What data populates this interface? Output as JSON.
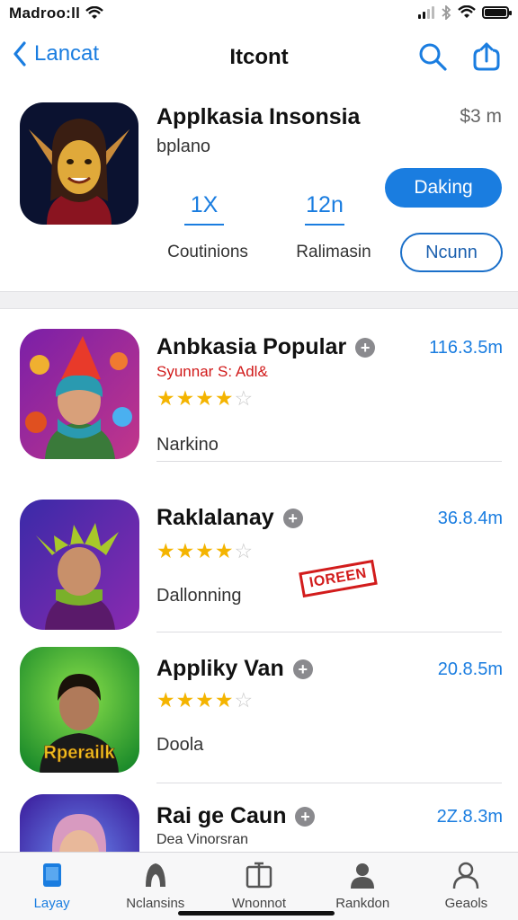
{
  "status_bar": {
    "carrier": "Madroo:ll",
    "battery_level": 1.0
  },
  "nav": {
    "back_label": "Lancat",
    "title": "Itcont"
  },
  "featured": {
    "name": "Applkasia Insonsia",
    "subtitle": "bplano",
    "price": "$3 m",
    "stat1_value": "1X",
    "stat1_label": "Coutinions",
    "stat2_value": "12n",
    "stat2_label": "Ralimasin",
    "primary_button": "Daking",
    "secondary_button": "Ncunn"
  },
  "apps": [
    {
      "name": "Anbkasia Popular",
      "developer": "Syunnar S: Adl&",
      "price": "116.3.5m",
      "rating": 4,
      "category": "Narkino",
      "badge": ""
    },
    {
      "name": "Raklalanay",
      "developer": "",
      "price": "36.8.4m",
      "rating": 4,
      "category": "Dallonning",
      "badge": "IOREEN"
    },
    {
      "name": "Appliky Van",
      "developer": "",
      "price": "20.8.5m",
      "rating": 3.5,
      "category": "Doola",
      "badge": "",
      "icon_caption": "Rperailk"
    },
    {
      "name": "Rai ge Caun",
      "developer": "",
      "price": "2Z.8.3m",
      "rating": null,
      "category": "Dea Vinorsran",
      "badge": ""
    }
  ],
  "tabs": [
    {
      "label": "Layay",
      "icon": "phone-icon",
      "active": true
    },
    {
      "label": "Nclansins",
      "icon": "rocket-icon",
      "active": false
    },
    {
      "label": "Wnonnot",
      "icon": "briefcase-icon",
      "active": false
    },
    {
      "label": "Rankdon",
      "icon": "person-icon",
      "active": false
    },
    {
      "label": "Geaols",
      "icon": "person-outline-icon",
      "active": false
    }
  ],
  "colors": {
    "accent": "#1a7de0",
    "star": "#f4b400",
    "warning": "#d11a1a"
  }
}
